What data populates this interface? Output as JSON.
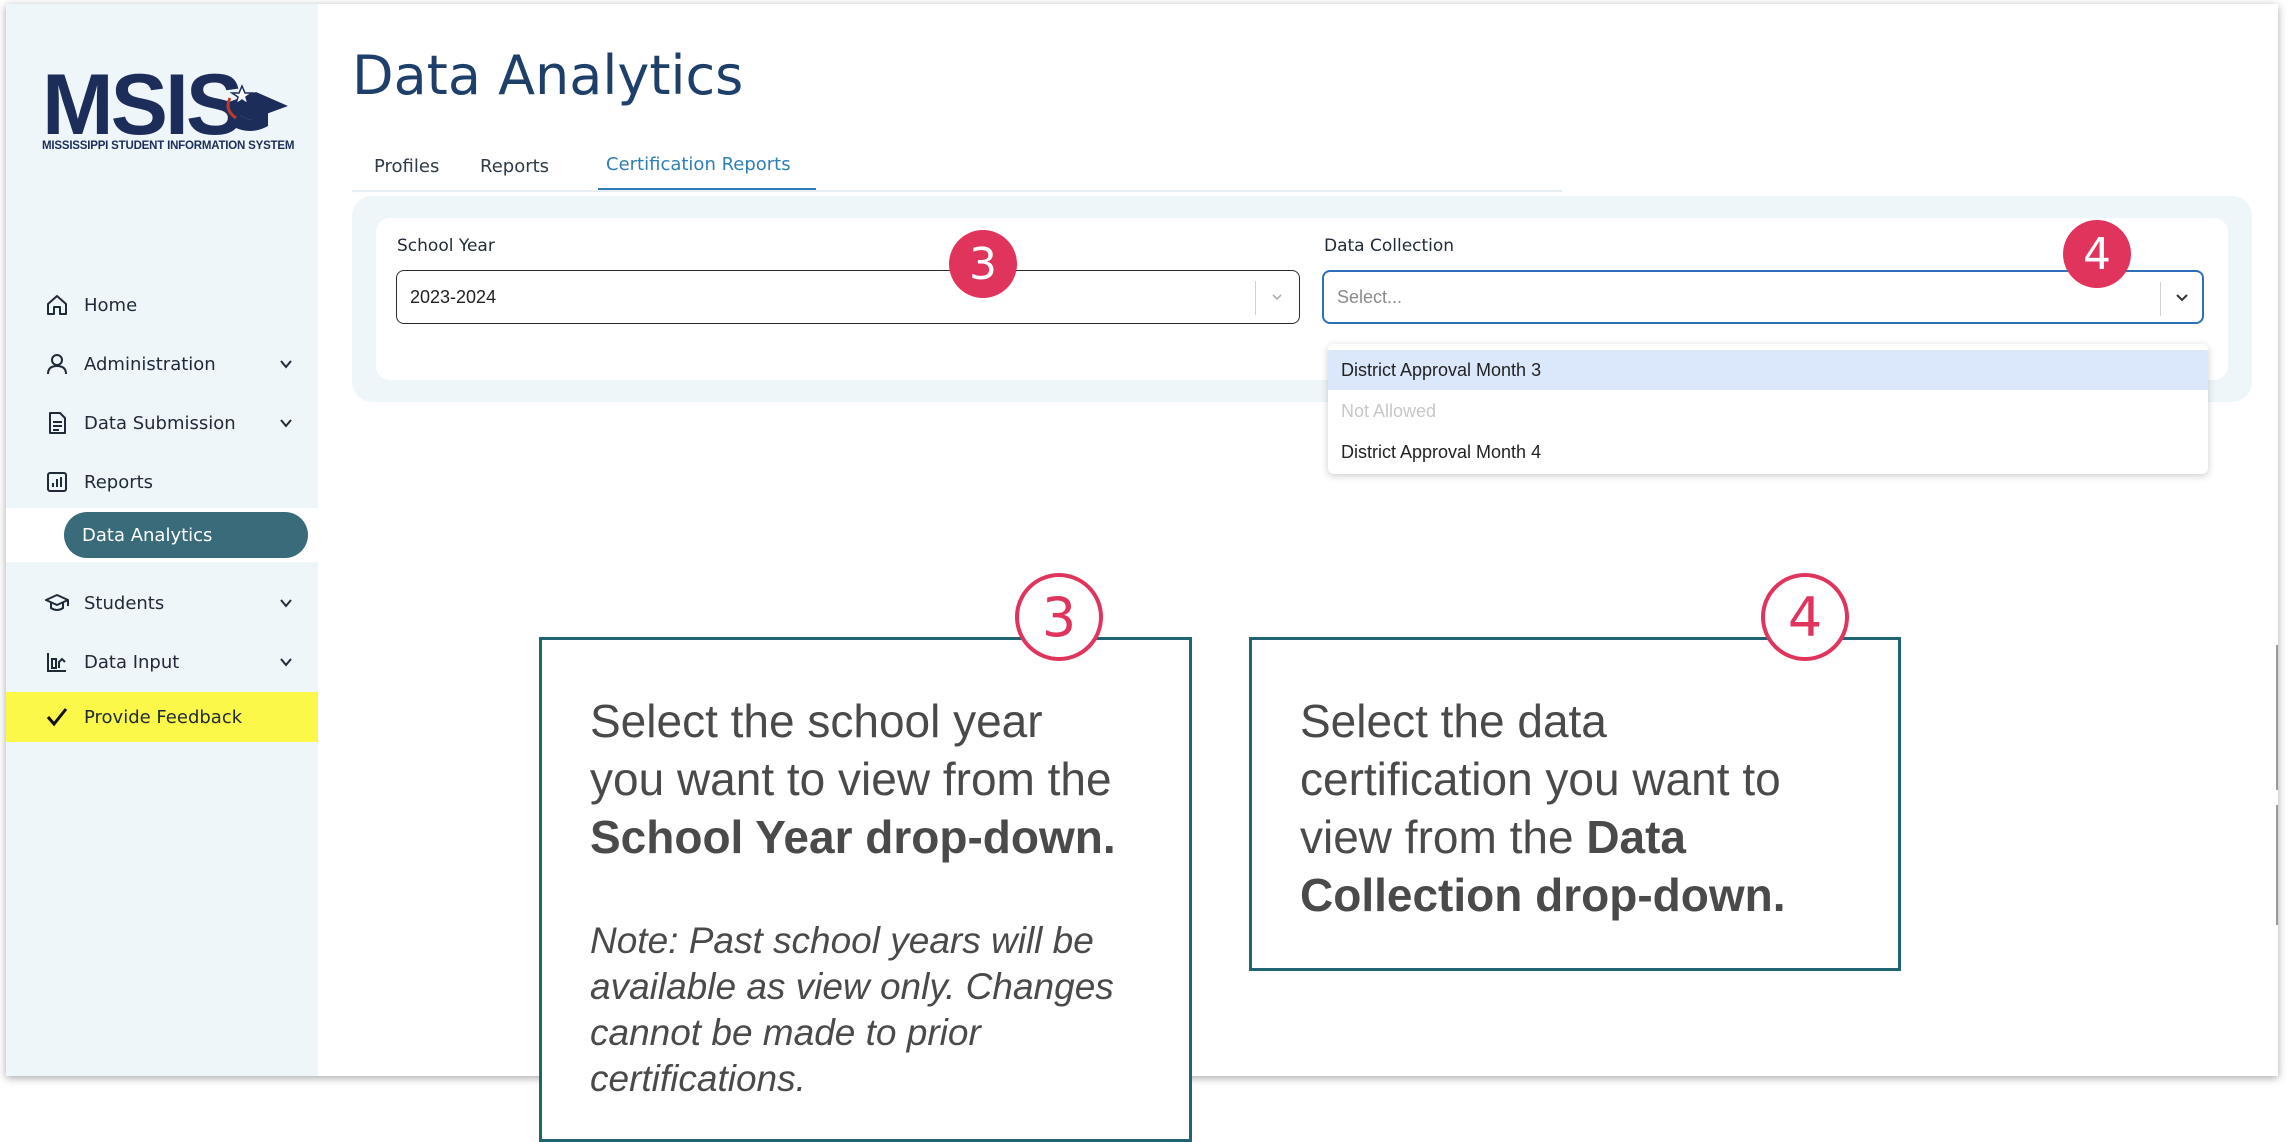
{
  "logo": {
    "text": "MSIS",
    "subtitle": "MISSISSIPPI STUDENT INFORMATION SYSTEM"
  },
  "sidebar": {
    "items": [
      {
        "label": "Home",
        "icon": "home-icon",
        "has_chevron": false
      },
      {
        "label": "Administration",
        "icon": "user-icon",
        "has_chevron": true
      },
      {
        "label": "Data Submission",
        "icon": "document-icon",
        "has_chevron": true
      },
      {
        "label": "Reports",
        "icon": "bar-chart-icon",
        "has_chevron": false
      },
      {
        "label": "Data Analytics",
        "icon": "",
        "has_chevron": false
      },
      {
        "label": "Students",
        "icon": "graduation-cap-icon",
        "has_chevron": true
      },
      {
        "label": "Data Input",
        "icon": "chart-input-icon",
        "has_chevron": true
      }
    ],
    "feedback": {
      "label": "Provide Feedback",
      "icon": "checkmark-icon",
      "color": "#fbf84a"
    }
  },
  "main": {
    "title": "Data Analytics",
    "tabs": [
      {
        "label": "Profiles",
        "active": false
      },
      {
        "label": "Reports",
        "active": false
      },
      {
        "label": "Certification Reports",
        "active": true
      }
    ],
    "filters": {
      "school_year": {
        "label": "School Year",
        "value": "2023-2024"
      },
      "data_collection": {
        "label": "Data Collection",
        "placeholder": "Select...",
        "options": [
          {
            "label": "District Approval Month 3",
            "highlighted": true,
            "disabled": false
          },
          {
            "label": "Not Allowed",
            "highlighted": false,
            "disabled": true
          },
          {
            "label": "District Approval Month 4",
            "highlighted": false,
            "disabled": false
          }
        ]
      }
    }
  },
  "annotations": {
    "badge_3": "3",
    "badge_4": "4",
    "callout_3": {
      "number": "3",
      "line1": "Select the school year",
      "line2": "you want to view from the",
      "bold": "School Year drop-down.",
      "note1": "Note: Past school years will be",
      "note2": "available as view only. Changes",
      "note3": "cannot be made to prior",
      "note4": "certifications."
    },
    "callout_4": {
      "number": "4",
      "line1": "Select the data",
      "line2": "certification you want to",
      "line3_plain": "view from the ",
      "line3_bold": "Data",
      "line4_bold": "Collection drop-down."
    }
  },
  "colors": {
    "accent": "#2e7fb5",
    "title": "#1d3f6a",
    "badge": "#e0345c",
    "callout_border": "#1f6470",
    "sidebar_bg": "#eef6f9",
    "active_nav": "#3a6b7a"
  }
}
